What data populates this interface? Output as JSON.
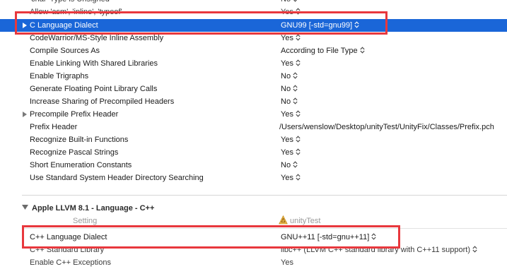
{
  "rows": [
    {
      "name": "'char' Type is Unsigned",
      "value": "No"
    },
    {
      "name": "Allow 'asm', 'inline', 'typeof'",
      "value": "Yes"
    },
    {
      "name": "C Language Dialect",
      "value": "GNU99 [-std=gnu99]"
    },
    {
      "name": "CodeWarrior/MS-Style Inline Assembly",
      "value": "Yes"
    },
    {
      "name": "Compile Sources As",
      "value": "According to File Type"
    },
    {
      "name": "Enable Linking With Shared Libraries",
      "value": "Yes"
    },
    {
      "name": "Enable Trigraphs",
      "value": "No"
    },
    {
      "name": "Generate Floating Point Library Calls",
      "value": "No"
    },
    {
      "name": "Increase Sharing of Precompiled Headers",
      "value": "No"
    },
    {
      "name": "Precompile Prefix Header",
      "value": "Yes"
    },
    {
      "name": "Prefix Header",
      "value": "/Users/wenslow/Desktop/unityTest/UnityFix/Classes/Prefix.pch"
    },
    {
      "name": "Recognize Built-in Functions",
      "value": "Yes"
    },
    {
      "name": "Recognize Pascal Strings",
      "value": "Yes"
    },
    {
      "name": "Short Enumeration Constants",
      "value": "No"
    },
    {
      "name": "Use Standard System Header Directory Searching",
      "value": "Yes"
    }
  ],
  "section": {
    "title": "Apple LLVM 8.1 - Language - C++",
    "col_setting": "Setting",
    "col_target": "unityTest"
  },
  "cpp_rows": [
    {
      "name": "C++ Language Dialect",
      "value": "GNU++11 [-std=gnu++11]"
    },
    {
      "name": "C++ Standard Library",
      "value": "libc++ (LLVM C++ standard library with C++11 support)"
    },
    {
      "name": "Enable C++ Exceptions",
      "value": "Yes"
    }
  ],
  "colors": {
    "selection": "#1a66d8",
    "highlight": "#e8383d"
  },
  "icons": {
    "stepper": "updown-chevron-icon",
    "disclosure": "disclosure-triangle-icon",
    "target": "app-target-icon"
  }
}
